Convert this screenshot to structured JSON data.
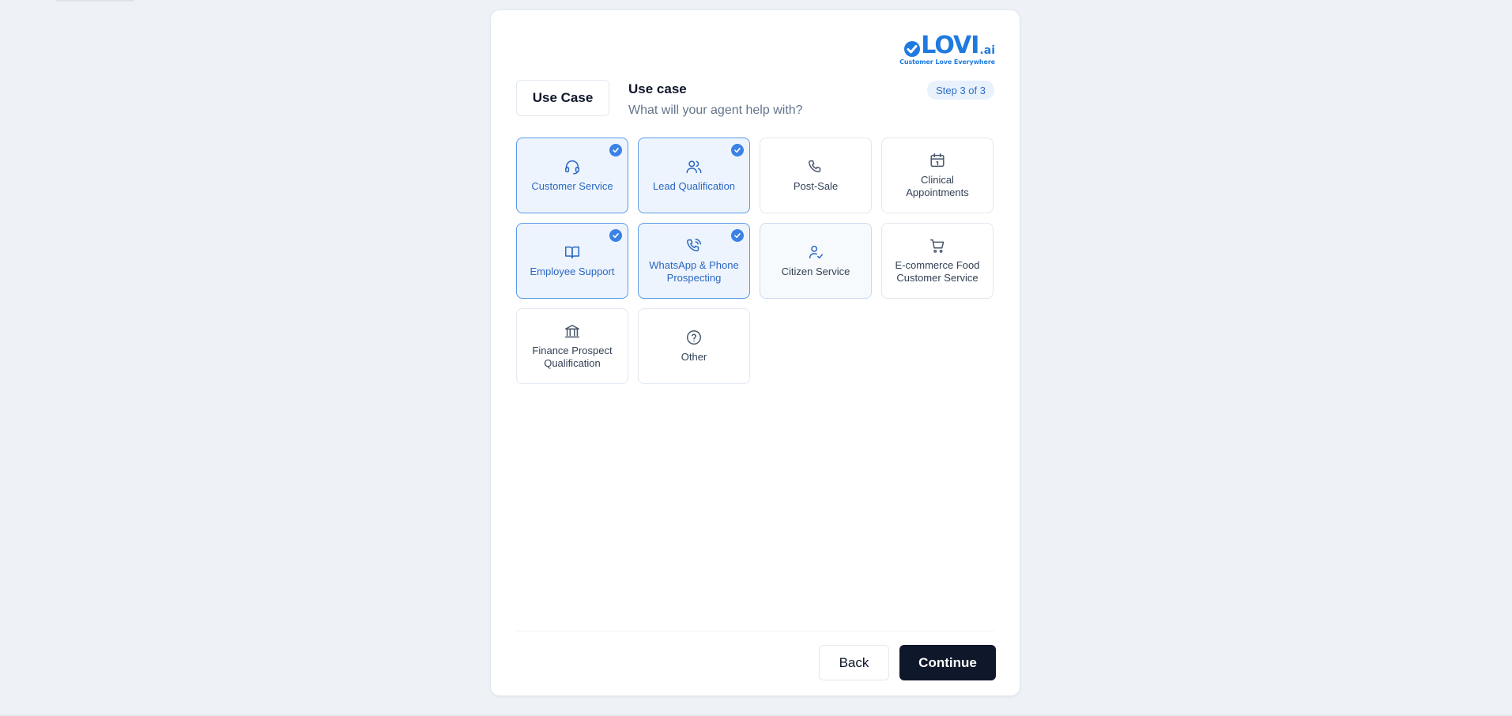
{
  "logo": {
    "wordmark": "LOVI",
    "suffix": ".ai",
    "tagline": "Customer Love Everywhere",
    "brand_color": "#1f7ae0"
  },
  "step_tab": {
    "label": "Use Case"
  },
  "section": {
    "title": "Use case",
    "subtitle": "What will your agent help with?"
  },
  "step_badge": {
    "label": "Step 3 of 3"
  },
  "options": [
    {
      "id": "customer-service",
      "label": "Customer Service",
      "icon": "headset-icon",
      "selected": true
    },
    {
      "id": "lead-qualification",
      "label": "Lead Qualification",
      "icon": "users-icon",
      "selected": true
    },
    {
      "id": "post-sale",
      "label": "Post-Sale",
      "icon": "phone-icon",
      "selected": false
    },
    {
      "id": "clinical-appointments",
      "label": "Clinical Appointments",
      "icon": "calendar-icon",
      "selected": false
    },
    {
      "id": "employee-support",
      "label": "Employee Support",
      "icon": "book-icon",
      "selected": true
    },
    {
      "id": "whatsapp-phone-prospecting",
      "label": "WhatsApp & Phone Prospecting",
      "icon": "phone-call-icon",
      "selected": true
    },
    {
      "id": "citizen-service",
      "label": "Citizen Service",
      "icon": "user-check-icon",
      "selected": false
    },
    {
      "id": "ecommerce-food",
      "label": "E-commerce Food Customer Service",
      "icon": "shopping-cart-icon",
      "selected": false
    },
    {
      "id": "finance-prospect",
      "label": "Finance Prospect Qualification",
      "icon": "bank-icon",
      "selected": false
    },
    {
      "id": "other",
      "label": "Other",
      "icon": "help-circle-icon",
      "selected": false
    }
  ],
  "footer": {
    "back_label": "Back",
    "continue_label": "Continue"
  },
  "colors": {
    "accent": "#3b82e6",
    "selected_bg": "#edf4fd",
    "primary_button": "#0f172a"
  }
}
